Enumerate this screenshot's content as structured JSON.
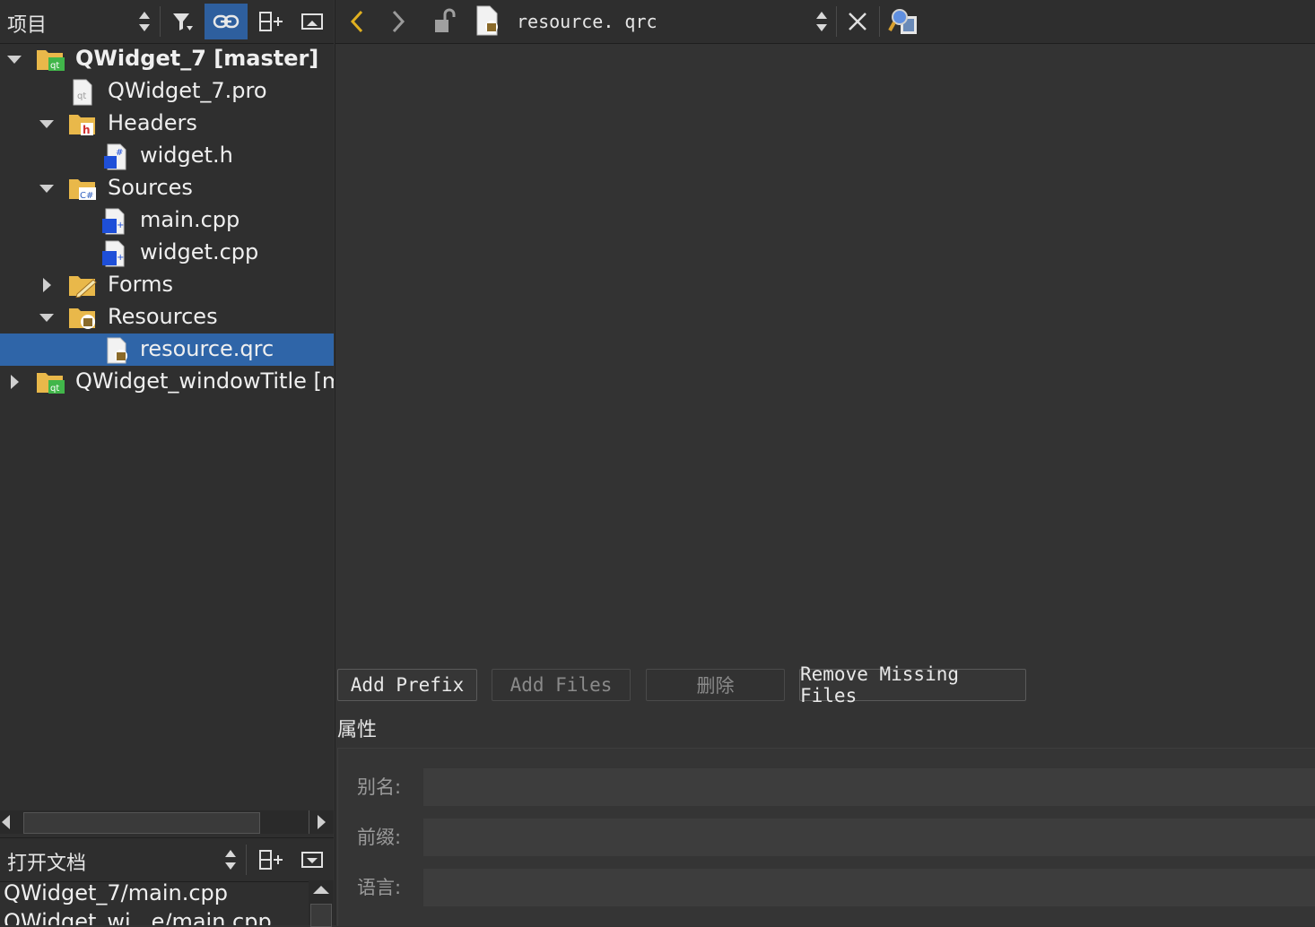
{
  "project_panel": {
    "title": "项目",
    "tree": [
      {
        "label": "QWidget_7 [master]",
        "bold": true
      },
      {
        "label": "QWidget_7.pro"
      },
      {
        "label": "Headers"
      },
      {
        "label": "widget.h"
      },
      {
        "label": "Sources"
      },
      {
        "label": "main.cpp"
      },
      {
        "label": "widget.cpp"
      },
      {
        "label": "Forms"
      },
      {
        "label": "Resources"
      },
      {
        "label": "resource.qrc",
        "selected": true
      },
      {
        "label": "QWidget_windowTitle [m"
      }
    ]
  },
  "open_docs": {
    "title": "打开文档",
    "items": [
      "QWidget_7/main.cpp",
      "QWidget_wi...e/main.cpp"
    ]
  },
  "editor": {
    "file_name": "resource. qrc"
  },
  "resource_editor": {
    "buttons": {
      "add_prefix": "Add Prefix",
      "add_files": "Add Files",
      "delete": "删除",
      "remove_missing": "Remove Missing Files"
    },
    "properties_title": "属性",
    "fields": {
      "alias_label": "别名:",
      "prefix_label": "前缀:",
      "language_label": "语言:",
      "alias_value": "",
      "prefix_value": "",
      "language_value": ""
    }
  },
  "colors": {
    "selection": "#2f65a8",
    "active_tool": "#2e5f9e",
    "back_arrow": "#e0b020"
  }
}
